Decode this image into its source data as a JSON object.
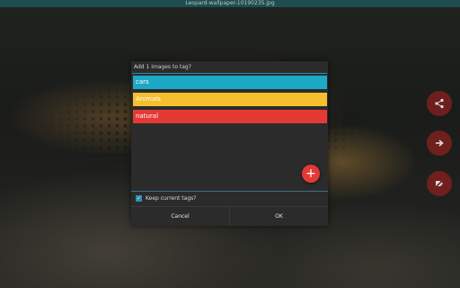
{
  "window": {
    "title": "Leopard-wallpaper-10190235.jpg"
  },
  "dialog": {
    "title": "Add 1 images to tag?",
    "tags": [
      {
        "label": "cars",
        "color": "#1da8c6"
      },
      {
        "label": "Animals",
        "color": "#f6bf2e"
      },
      {
        "label": "natural",
        "color": "#e53935"
      }
    ],
    "add_icon": "plus-icon",
    "keep_tags_label": "Keep current tags?",
    "keep_tags_checked": true,
    "cancel_label": "Cancel",
    "ok_label": "OK"
  },
  "side_actions": [
    {
      "icon": "share-icon"
    },
    {
      "icon": "arrow-right-icon"
    },
    {
      "icon": "label-off-icon"
    }
  ]
}
